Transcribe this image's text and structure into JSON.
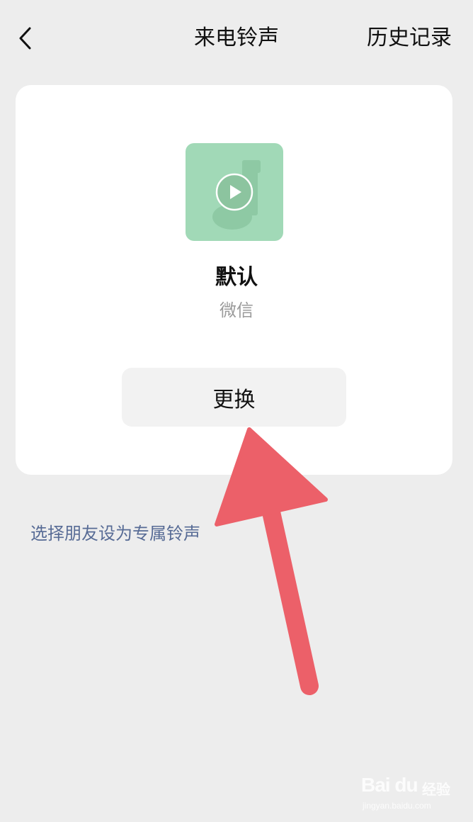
{
  "nav": {
    "title": "来电铃声",
    "history_label": "历史记录"
  },
  "ringtone": {
    "name": "默认",
    "source": "微信",
    "change_label": "更换",
    "cover_color": "#a1d9b7"
  },
  "friend_link": "选择朋友设为专属铃声",
  "annotation": {
    "arrow_color": "#ec6069"
  },
  "watermark": {
    "logo": "Bai  du",
    "product": "经验",
    "url": "jingyan.baidu.com"
  },
  "colors": {
    "background": "#ededed",
    "card": "#ffffff",
    "link": "#576b95",
    "button_bg": "#f2f2f2"
  }
}
